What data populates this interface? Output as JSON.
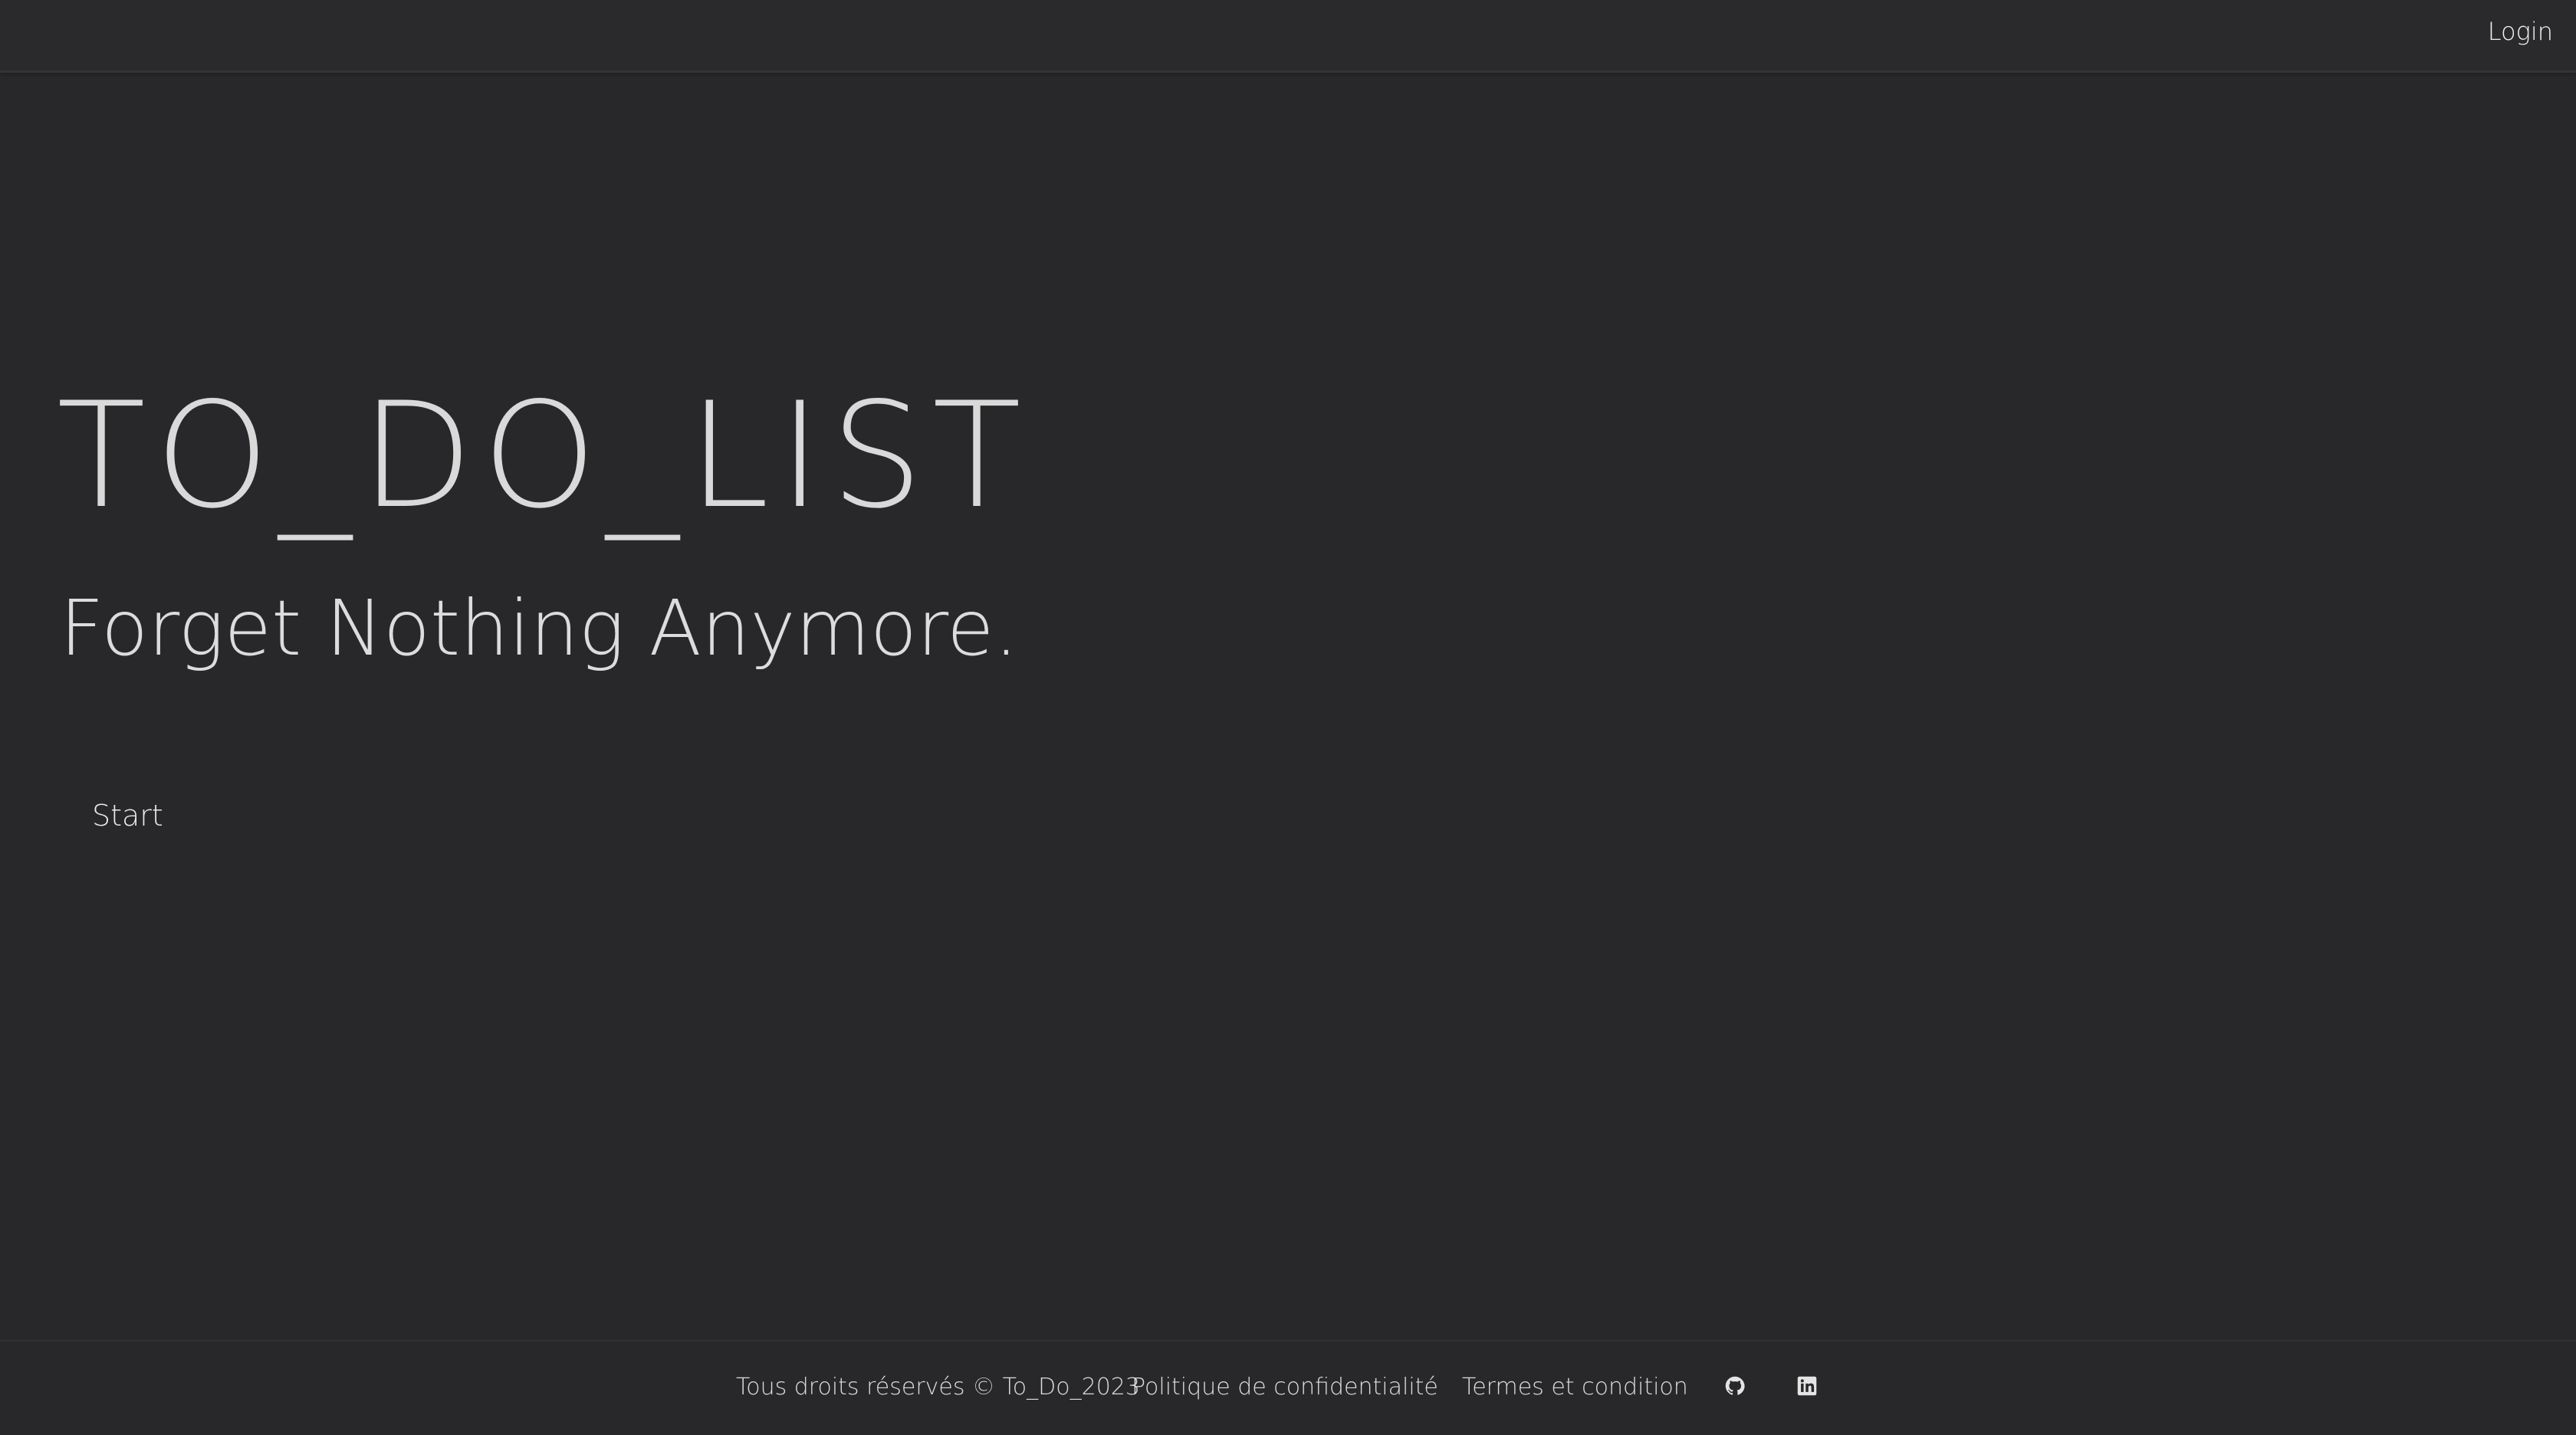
{
  "navbar": {
    "login_label": "Login"
  },
  "hero": {
    "title": "TO_DO_LIST",
    "subtitle": "Forget Nothing Anymore.",
    "start_label": "Start"
  },
  "footer": {
    "copyright": "Tous droits réservés © To_Do_2023",
    "privacy_label": "Politique de confidentialité",
    "terms_label": "Termes et condition",
    "icons": [
      "github-icon",
      "linkedin-icon"
    ]
  },
  "colors": {
    "background": "#28282a",
    "text": "#e2e2e2"
  }
}
